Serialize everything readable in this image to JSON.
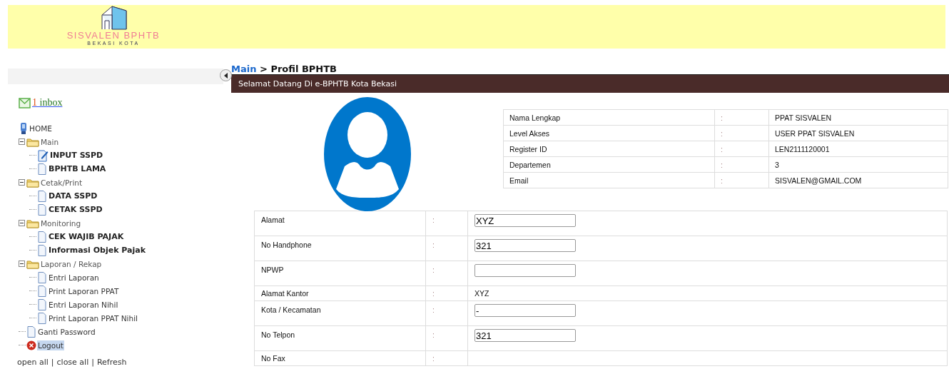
{
  "header": {
    "logo_title": "SISVALEN BPHTB",
    "logo_subtitle": "BEKASI KOTA"
  },
  "sidebar": {
    "inbox": {
      "count": "1",
      "label": "inbox"
    },
    "tree": [
      {
        "kind": "home",
        "label": "HOME",
        "bold": false,
        "selected": false
      },
      {
        "kind": "folder",
        "label": "Main",
        "expanded": true,
        "children": [
          {
            "kind": "edit",
            "label": "INPUT SSPD",
            "bold": true,
            "selected": false
          },
          {
            "kind": "page",
            "label": "BPHTB LAMA",
            "bold": true,
            "selected": false
          }
        ]
      },
      {
        "kind": "folder",
        "label": "Cetak/Print",
        "expanded": true,
        "children": [
          {
            "kind": "page",
            "label": "DATA SSPD",
            "bold": true,
            "selected": false
          },
          {
            "kind": "page",
            "label": "CETAK SSPD",
            "bold": true,
            "selected": false
          }
        ]
      },
      {
        "kind": "folder",
        "label": "Monitoring",
        "expanded": true,
        "children": [
          {
            "kind": "page",
            "label": "CEK WAJIB PAJAK",
            "bold": true,
            "selected": false
          },
          {
            "kind": "page",
            "label": "Informasi Objek Pajak",
            "bold": true,
            "selected": false
          }
        ]
      },
      {
        "kind": "folder",
        "label": "Laporan / Rekap",
        "expanded": true,
        "children": [
          {
            "kind": "page",
            "label": "Entri Laporan",
            "bold": false,
            "selected": false
          },
          {
            "kind": "page",
            "label": "Print Laporan PPAT",
            "bold": false,
            "selected": false
          },
          {
            "kind": "page",
            "label": "Entri Laporan Nihil",
            "bold": false,
            "selected": false
          },
          {
            "kind": "page",
            "label": "Print Laporan PPAT Nihil",
            "bold": false,
            "selected": false
          }
        ]
      },
      {
        "kind": "page",
        "label": "Ganti Password",
        "bold": false,
        "selected": false
      },
      {
        "kind": "logout",
        "label": "Logout",
        "bold": false,
        "selected": true
      }
    ],
    "footer_links": [
      "open all",
      "close all",
      "Refresh"
    ],
    "footer_separator": "|"
  },
  "breadcrumb": {
    "link": "Main",
    "separator": ">",
    "current": "Profil BPHTB"
  },
  "banner": "Selamat Datang Di e-BPHTB Kota Bekasi",
  "account": [
    {
      "label": "Nama Lengkap",
      "colon": ":",
      "value": "PPAT SISVALEN"
    },
    {
      "label": "Level Akses",
      "colon": ":",
      "value": "USER PPAT SISVALEN"
    },
    {
      "label": "Register ID",
      "colon": ":",
      "value": "LEN2111120001"
    },
    {
      "label": "Departemen",
      "colon": ":",
      "value": "3"
    },
    {
      "label": "Email",
      "colon": ":",
      "value": "SISVALEN@GMAIL.COM"
    }
  ],
  "profile": [
    {
      "kind": "input",
      "label": "Alamat",
      "colon": ":",
      "value": "XYZ"
    },
    {
      "kind": "input",
      "label": "No Handphone",
      "colon": ":",
      "value": "321"
    },
    {
      "kind": "input",
      "label": "NPWP",
      "colon": ":"
    },
    {
      "kind": "text",
      "label": "Alamat Kantor",
      "colon": ":",
      "value": "XYZ"
    },
    {
      "kind": "input",
      "label": "Kota / Kecamatan",
      "colon": ":",
      "value": "-"
    },
    {
      "kind": "input",
      "label": "No Telpon",
      "colon": ":",
      "value": "321"
    },
    {
      "kind": "blank",
      "label": "No Fax",
      "colon": ":"
    }
  ]
}
